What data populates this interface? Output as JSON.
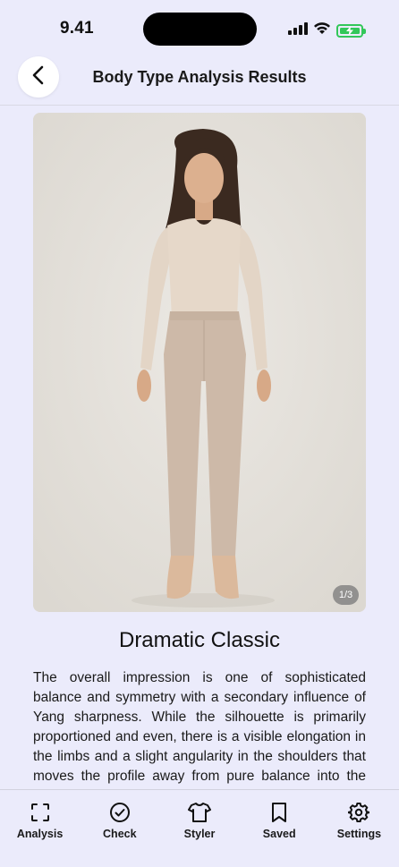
{
  "status": {
    "time": "9.41"
  },
  "header": {
    "title": "Body Type Analysis Results"
  },
  "gallery": {
    "indicator": "1/3"
  },
  "result": {
    "title": "Dramatic Classic",
    "description": "The overall impression is one of sophisticated balance and symmetry with a secondary influence of Yang sharpness. While the silhouette is primarily proportioned and even, there is a visible elongation in the limbs and a slight angularity in the shoulders that moves the profile away from pure balance into the Dramatic Classic territory."
  },
  "nav": {
    "items": [
      {
        "label": "Analysis",
        "icon": "scan-icon"
      },
      {
        "label": "Check",
        "icon": "check-circle-icon"
      },
      {
        "label": "Styler",
        "icon": "shirt-icon"
      },
      {
        "label": "Saved",
        "icon": "bookmark-icon"
      },
      {
        "label": "Settings",
        "icon": "gear-icon"
      }
    ]
  },
  "colors": {
    "background": "#ebebfb",
    "battery": "#32c759"
  }
}
